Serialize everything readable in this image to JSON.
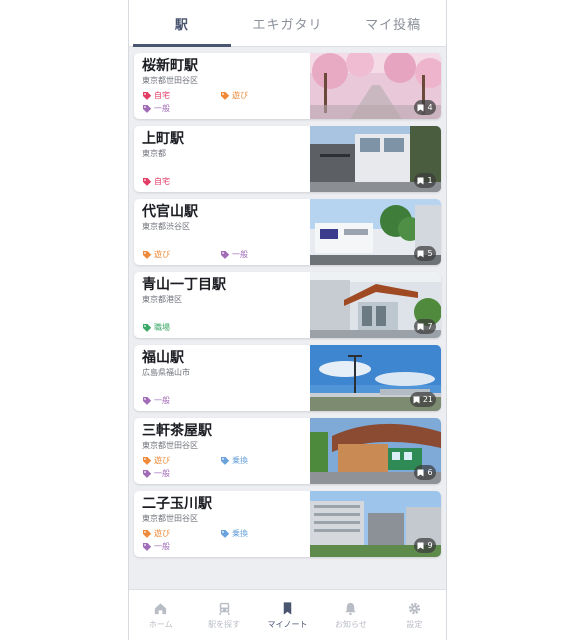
{
  "tabs": [
    {
      "label": "駅",
      "active": true
    },
    {
      "label": "エキガタリ",
      "active": false
    },
    {
      "label": "マイ投稿",
      "active": false
    }
  ],
  "tag_colors": {
    "red": "#e23b64",
    "orange": "#ef8a3a",
    "purple": "#a26bb8",
    "green": "#3aa866",
    "blue": "#6aa3dc"
  },
  "stations": [
    {
      "name": "桜新町駅",
      "address": "東京都世田谷区",
      "count": "4",
      "tags": [
        {
          "label": "自宅",
          "color": "red"
        },
        {
          "label": "遊び",
          "color": "orange"
        },
        {
          "label": "一般",
          "color": "purple"
        }
      ]
    },
    {
      "name": "上町駅",
      "address": "東京都",
      "count": "1",
      "tags": [
        {
          "label": "自宅",
          "color": "red"
        }
      ]
    },
    {
      "name": "代官山駅",
      "address": "東京都渋谷区",
      "count": "5",
      "tags": [
        {
          "label": "遊び",
          "color": "orange"
        },
        {
          "label": "一般",
          "color": "purple"
        }
      ]
    },
    {
      "name": "青山一丁目駅",
      "address": "東京都港区",
      "count": "7",
      "tags": [
        {
          "label": "職場",
          "color": "green"
        }
      ]
    },
    {
      "name": "福山駅",
      "address": "広島県福山市",
      "count": "21",
      "tags": [
        {
          "label": "一般",
          "color": "purple"
        }
      ]
    },
    {
      "name": "三軒茶屋駅",
      "address": "東京都世田谷区",
      "count": "6",
      "tags": [
        {
          "label": "遊び",
          "color": "orange"
        },
        {
          "label": "乗換",
          "color": "blue"
        },
        {
          "label": "一般",
          "color": "purple"
        }
      ]
    },
    {
      "name": "二子玉川駅",
      "address": "東京都世田谷区",
      "count": "9",
      "tags": [
        {
          "label": "遊び",
          "color": "orange"
        },
        {
          "label": "乗換",
          "color": "blue"
        },
        {
          "label": "一般",
          "color": "purple"
        }
      ]
    }
  ],
  "bottom_nav": [
    {
      "label": "ホーム",
      "icon": "home-icon",
      "active": false
    },
    {
      "label": "駅を探す",
      "icon": "train-icon",
      "active": false
    },
    {
      "label": "マイノート",
      "icon": "bookmark-icon",
      "active": true
    },
    {
      "label": "お知らせ",
      "icon": "bell-icon",
      "active": false
    },
    {
      "label": "設定",
      "icon": "gear-icon",
      "active": false
    }
  ]
}
